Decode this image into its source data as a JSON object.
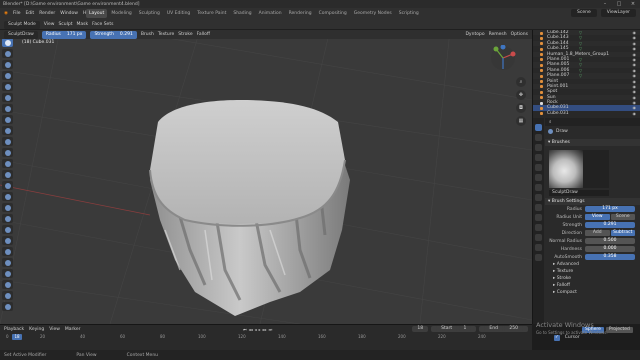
{
  "window": {
    "title": "Blender* [D:\\Game environment\\Game environment4.blend]",
    "controls": [
      "–",
      "□",
      "×"
    ]
  },
  "menu": {
    "items": [
      "File",
      "Edit",
      "Render",
      "Window",
      "Help"
    ]
  },
  "workspaces": [
    "Layout",
    "Modeling",
    "Sculpting",
    "UV Editing",
    "Texture Paint",
    "Shading",
    "Animation",
    "Rendering",
    "Compositing",
    "Geometry Nodes",
    "Scripting"
  ],
  "active_workspace": "Layout",
  "scene": {
    "scene_label": "Scene",
    "view_layer_label": "ViewLayer"
  },
  "tool_header": {
    "mode": "Sculpt Mode",
    "view": "View",
    "sculpt": "Sculpt",
    "mask": "Mask",
    "face_sets": "Face Sets",
    "brush_name": "SculptDraw",
    "radius_label": "Radius",
    "radius_value": "171 px",
    "strength_label": "Strength",
    "strength_value": "0.291",
    "brush_menu": "Brush",
    "texture_menu": "Texture",
    "stroke_menu": "Stroke",
    "falloff_menu": "Falloff",
    "dyntopo": "Dyntopo",
    "remesh": "Remesh",
    "options": "Options"
  },
  "viewport": {
    "perspective": "User Perspective (Local)",
    "object": "(18) Cube.031"
  },
  "outliner": {
    "rows": [
      {
        "name": "Cube.142",
        "selected": false
      },
      {
        "name": "Cube.143",
        "selected": false
      },
      {
        "name": "Cube.144",
        "selected": false
      },
      {
        "name": "Cube.145",
        "selected": false
      },
      {
        "name": "Human_1.8_Meters_Group1",
        "selected": false
      },
      {
        "name": "Plane.001",
        "selected": false
      },
      {
        "name": "Plane.005",
        "selected": false
      },
      {
        "name": "Plane.006",
        "selected": false
      },
      {
        "name": "Plane.007",
        "selected": false
      },
      {
        "name": "Point",
        "selected": false
      },
      {
        "name": "Point.001",
        "selected": false
      },
      {
        "name": "Spot",
        "selected": false
      },
      {
        "name": "Sun",
        "selected": false
      },
      {
        "name": "Rock",
        "selected": false
      },
      {
        "name": "Cube.031",
        "selected": true
      },
      {
        "name": "Cube.031",
        "selected": false
      }
    ]
  },
  "properties": {
    "tool_name": "Draw",
    "brushes_panel": "Brushes",
    "brush_thumb_name": "SculptDraw",
    "brush_settings_panel": "Brush Settings",
    "radius_label": "Radius",
    "radius_value": "171 px",
    "radius_unit_label": "Radius Unit",
    "radius_unit_options": [
      "View",
      "Scene"
    ],
    "radius_unit_selected": "View",
    "strength_label": "Strength",
    "strength_value": "0.291",
    "direction_label": "Direction",
    "direction_options": [
      "Add",
      "Subtract"
    ],
    "direction_selected": "Add",
    "normal_radius_label": "Normal Radius",
    "normal_radius_value": "0.500",
    "hardness_label": "Hardness",
    "hardness_value": "0.000",
    "autosmooth_label": "AutoSmooth",
    "autosmooth_value": "0.358",
    "sub_panels": [
      "Advanced",
      "Texture",
      "Stroke",
      "Falloff"
    ],
    "cursor_panel": "Cursor",
    "compact_label": "Compact",
    "falloff_shape_label": "Falloff Shape",
    "falloff_shape_options": [
      "Sphere",
      "Projected"
    ],
    "falloff_selected": "Sphere"
  },
  "timeline": {
    "playback": "Playback",
    "keying": "Keying",
    "view": "View",
    "marker": "Marker",
    "current_frame": "18",
    "start_label": "Start",
    "start_value": "1",
    "end_label": "End",
    "end_value": "250",
    "ruler": [
      "0",
      "20",
      "40",
      "60",
      "80",
      "100",
      "120",
      "140",
      "160",
      "180",
      "200",
      "220",
      "240"
    ],
    "cursor_frame": "18"
  },
  "statusbar": {
    "left": "Set Active Modifier",
    "middle": "Pan View",
    "right": "Context Menu"
  },
  "watermark": {
    "line1": "Activate Windows",
    "line2": "Go to Settings to activate Windows."
  },
  "colors": {
    "accent": "#4772b3",
    "viewport_bg": "#3a3a3a",
    "mesh": "#bdbdbd"
  }
}
